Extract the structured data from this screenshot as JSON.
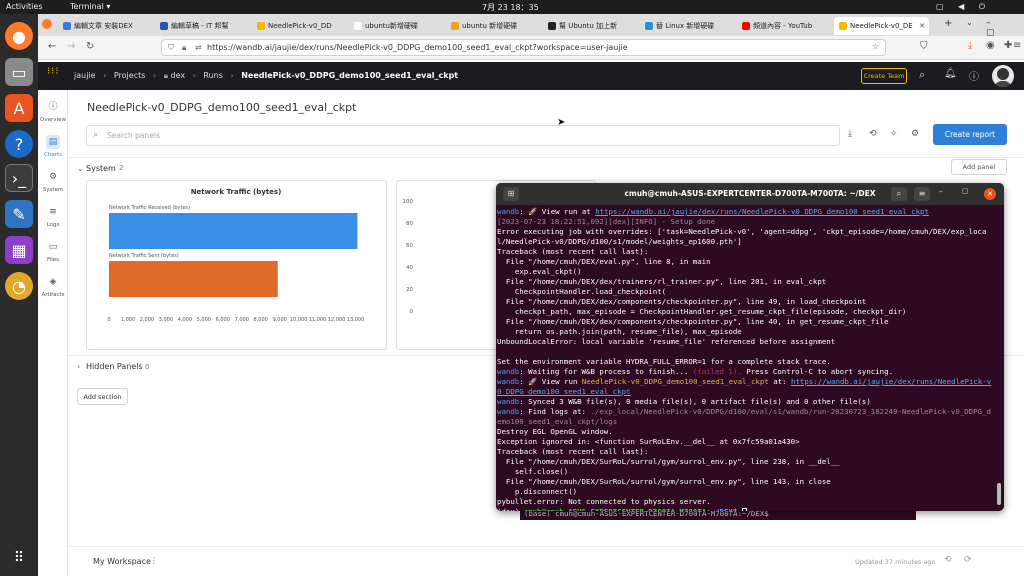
{
  "topbar": {
    "activities": "Activities",
    "app": "Terminal ▾",
    "clock": "7月 23 18：35"
  },
  "tabs": [
    {
      "label": "編輯文章 安裝DEX",
      "color": "#3a7bd5"
    },
    {
      "label": "編輯草稿 - IT 邦幫",
      "color": "#1e5aa8"
    },
    {
      "label": "NeedlePick-v0_DD",
      "color": "#f5b800"
    },
    {
      "label": "ubuntu新增硬碟",
      "color": "#ffffff"
    },
    {
      "label": "ubuntu 新增硬碟",
      "color": "#f0a020"
    },
    {
      "label": "幫 Ubuntu 加上新",
      "color": "#222222"
    },
    {
      "label": "替 Linux 新增硬碟",
      "color": "#2d8fd5"
    },
    {
      "label": "頻道內容 - YouTub",
      "color": "#ff0000"
    },
    {
      "label": "NeedlePick-v0_DE",
      "color": "#f5b800"
    }
  ],
  "url": "https://wandb.ai/jaujie/dex/runs/NeedlePick-v0_DDPG_demo100_seed1_eval_ckpt?workspace=user-jaujie",
  "header": {
    "user": "jaujie",
    "projects": "Projects",
    "project": "dex",
    "runs": "Runs",
    "run": "NeedlePick-v0_DDPG_demo100_seed1_eval_ckpt",
    "create_team": "Create Team"
  },
  "sidebar": [
    {
      "label": "Overview",
      "icon": "ⓘ"
    },
    {
      "label": "Charts",
      "icon": "▤"
    },
    {
      "label": "System",
      "icon": "⚙"
    },
    {
      "label": "Logs",
      "icon": "≡"
    },
    {
      "label": "Files",
      "icon": "▭"
    },
    {
      "label": "Artifacts",
      "icon": "◈"
    }
  ],
  "main": {
    "title": "NeedlePick-v0_DDPG_demo100_seed1_eval_ckpt",
    "search_placeholder": "Search panels",
    "create_report": "Create report",
    "section_system": "System",
    "section_system_count": "2",
    "add_panel": "Add panel",
    "hidden_panels": "Hidden Panels",
    "hidden_count": "0",
    "add_section": "Add section"
  },
  "chart_data": [
    {
      "type": "bar",
      "title": "Network Traffic (bytes)",
      "categories": [
        "Network Traffic Received (bytes)",
        "Network Traffic Sent (bytes)"
      ],
      "values": [
        13100,
        8900
      ],
      "xlim": [
        0,
        13500
      ],
      "xticks": [
        "0",
        "1,000",
        "2,000",
        "3,000",
        "4,000",
        "5,000",
        "6,000",
        "7,000",
        "8,000",
        "9,000",
        "10,000",
        "11,000",
        "12,000",
        "13,000"
      ],
      "colors": [
        "#3a8ee6",
        "#e06c2c"
      ]
    },
    {
      "type": "line",
      "title": "",
      "yticks": [
        "100",
        "80",
        "60",
        "40",
        "20",
        "0"
      ],
      "ylim": [
        0,
        100
      ]
    }
  ],
  "terminal": {
    "title": "cmuh@cmuh-ASUS-EXPERTCENTER-D700TA-M700TA: ~/DEX",
    "lines": [
      {
        "segs": [
          {
            "c": "pre",
            "t": "wandb"
          },
          {
            "t": ": 🚀 View run at "
          },
          {
            "c": "link",
            "t": "https://wandb.ai/jaujie/dex/runs/NeedlePick-v0_DDPG_demo100_seed1_eval_ckpt"
          }
        ]
      },
      {
        "segs": [
          {
            "c": "dim",
            "t": "[2023-07-23 18:22:51,092][dex][INFO] - Setup done"
          }
        ]
      },
      {
        "segs": [
          {
            "t": "Error executing job with overrides: ['task=NeedlePick-v0', 'agent=ddpg', 'ckpt_episode=/home/cmuh/DEX/exp_local/NeedlePick-v0/DDPG/d100/s1/model/weights_ep1600.pth']"
          }
        ]
      },
      {
        "segs": [
          {
            "t": "Traceback (most recent call last):"
          }
        ]
      },
      {
        "segs": [
          {
            "t": "  File \"/home/cmuh/DEX/eval.py\", line 8, in main"
          }
        ]
      },
      {
        "segs": [
          {
            "t": "    exp.eval_ckpt()"
          }
        ]
      },
      {
        "segs": [
          {
            "t": "  File \"/home/cmuh/DEX/dex/trainers/rl_trainer.py\", line 201, in eval_ckpt"
          }
        ]
      },
      {
        "segs": [
          {
            "t": "    CheckpointHandler.load_checkpoint("
          }
        ]
      },
      {
        "segs": [
          {
            "t": "  File \"/home/cmuh/DEX/dex/components/checkpointer.py\", line 49, in load_checkpoint"
          }
        ]
      },
      {
        "segs": [
          {
            "t": "    checkpt_path, max_episode = CheckpointHandler.get_resume_ckpt_file(episode, checkpt_dir)"
          }
        ]
      },
      {
        "segs": [
          {
            "t": "  File \"/home/cmuh/DEX/dex/components/checkpointer.py\", line 40, in get_resume_ckpt_file"
          }
        ]
      },
      {
        "segs": [
          {
            "t": "    return os.path.join(path, resume_file), max_episode"
          }
        ]
      },
      {
        "segs": [
          {
            "t": "UnboundLocalError: local variable 'resume_file' referenced before assignment"
          }
        ]
      },
      {
        "segs": [
          {
            "t": " "
          }
        ]
      },
      {
        "segs": [
          {
            "t": "Set the environment variable HYDRA_FULL_ERROR=1 for a complete stack trace."
          }
        ]
      },
      {
        "segs": [
          {
            "c": "pre",
            "t": "wandb"
          },
          {
            "t": ": Waiting for W&B process to finish... "
          },
          {
            "c": "rd",
            "t": "(failed 1)."
          },
          {
            "t": " Press Control-C to abort syncing."
          }
        ]
      },
      {
        "segs": [
          {
            "c": "pre",
            "t": "wandb"
          },
          {
            "t": ": 🚀 View run "
          },
          {
            "c": "yl",
            "t": "NeedlePick-v0_DDPG_demo100_seed1_eval_ckpt"
          },
          {
            "t": " at: "
          },
          {
            "c": "link",
            "t": "https://wandb.ai/jaujie/dex/runs/NeedlePick-v0_DDPG_demo100_seed1_eval_ckpt"
          }
        ]
      },
      {
        "segs": [
          {
            "c": "pre",
            "t": "wandb"
          },
          {
            "t": ": Synced 3 W&B file(s), 0 media file(s), 0 artifact file(s) and 0 other file(s)"
          }
        ]
      },
      {
        "segs": [
          {
            "c": "pre",
            "t": "wandb"
          },
          {
            "t": ": Find logs at: "
          },
          {
            "c": "dim",
            "t": "./exp_local/NeedlePick-v0/DDPG/d100/eval/s1/wandb/run-20230723_182249-NeedlePick-v0_DDPG_demo100_seed1_eval_ckpt/logs"
          }
        ]
      },
      {
        "segs": [
          {
            "t": "Destroy EGL OpenGL window."
          }
        ]
      },
      {
        "segs": [
          {
            "t": "Exception ignored in: <function SurRoLEnv.__del__ at 0x7fc59a01a430>"
          }
        ]
      },
      {
        "segs": [
          {
            "t": "Traceback (most recent call last):"
          }
        ]
      },
      {
        "segs": [
          {
            "t": "  File \"/home/cmuh/DEX/SurRoL/surrol/gym/surrol_env.py\", line 238, in __del__"
          }
        ]
      },
      {
        "segs": [
          {
            "t": "    self.close()"
          }
        ]
      },
      {
        "segs": [
          {
            "t": "  File \"/home/cmuh/DEX/SurRoL/surrol/gym/surrol_env.py\", line 143, in close"
          }
        ]
      },
      {
        "segs": [
          {
            "t": "    p.disconnect()"
          }
        ]
      },
      {
        "segs": [
          {
            "t": "pybullet.error: Not connected to physics server."
          }
        ]
      },
      {
        "segs": [
          {
            "t": "(dex) "
          },
          {
            "c": "gn",
            "t": "cmuh@cmuh-ASUS-EXPERTCENTER-D700TA-M700TA"
          },
          {
            "t": ":"
          },
          {
            "c": "bl",
            "t": "~/DEX"
          },
          {
            "t": "$ "
          }
        ]
      }
    ],
    "bg_prompt": "(base) cmuh@cmuh-ASUS-EXPERTCENTER-D700TA-M700TA:~/DEX$ "
  },
  "footer": {
    "workspace": "My Workspace",
    "updated": "Updated 37 minutes ago"
  }
}
